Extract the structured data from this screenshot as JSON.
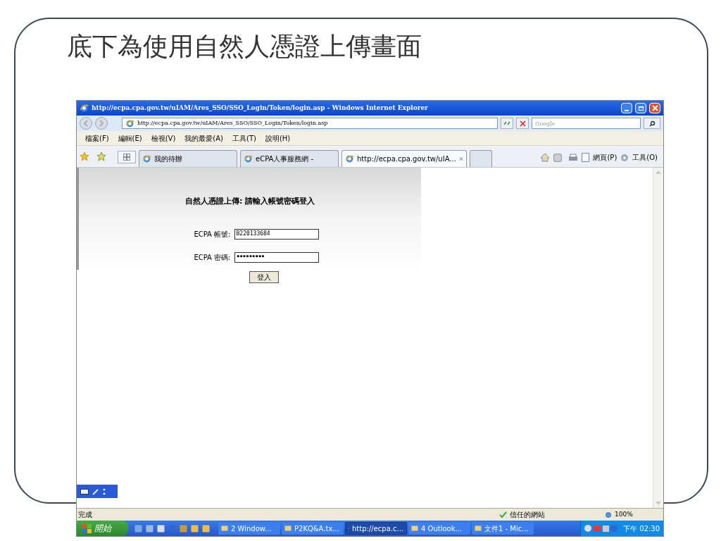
{
  "slide": {
    "title": "底下為使用自然人憑證上傳畫面"
  },
  "browser": {
    "title": "http://ecpa.cpa.gov.tw/uIAM/Ares_SSO/SSO_Login/Token/login.asp - Windows Internet Explorer",
    "address": "http://ecpa.cpa.gov.tw/uIAM/Ares_SSO/SSO_Login/Token/login.asp",
    "search_placeholder": "Google",
    "menu": [
      "檔案(F)",
      "編輯(E)",
      "檢視(V)",
      "我的最愛(A)",
      "工具(T)",
      "說明(H)"
    ],
    "tabs": [
      {
        "label": "我的待辦",
        "selected": false
      },
      {
        "label": "eCPA人事服務網 -",
        "selected": false
      },
      {
        "label": "http://ecpa.cpa.gov.tw/uIA...",
        "selected": true
      }
    ],
    "command_bar": [
      "網頁(P)",
      "工具(O)"
    ],
    "page": {
      "heading": "自然人憑證上傳: 請輸入帳號密碼登入",
      "fields": [
        {
          "label": "ECPA 帳號:",
          "value": "B220133684",
          "kind": "text"
        },
        {
          "label": "ECPA 密碼:",
          "value": "•••••••••",
          "kind": "password"
        }
      ],
      "button": "登入"
    },
    "status": {
      "text": "完成",
      "zone": "信任的網站",
      "zoom": "100%"
    }
  },
  "taskbar": {
    "start": "開始",
    "items": [
      {
        "label": "2 Window...",
        "selected": false
      },
      {
        "label": "P2KQ&A.tx...",
        "selected": false
      },
      {
        "label": "http://ecpa.c...",
        "selected": true
      },
      {
        "label": "4 Outlook...",
        "selected": false
      },
      {
        "label": "文件1 - Mic...",
        "selected": false
      }
    ],
    "clock": "下午 02:30"
  }
}
